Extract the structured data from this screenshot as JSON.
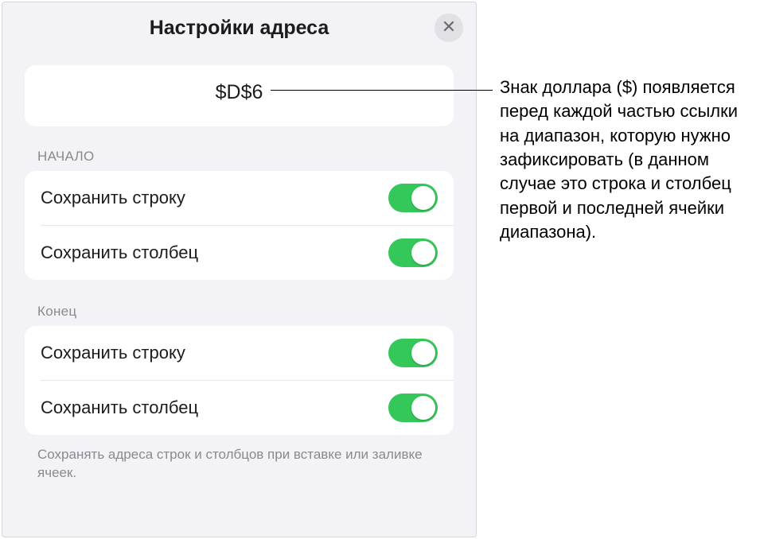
{
  "panel": {
    "title": "Настройки адреса",
    "formula": "$D$6"
  },
  "sections": {
    "start": {
      "label": "НАЧАЛО",
      "rows": [
        {
          "label": "Сохранить строку",
          "on": true
        },
        {
          "label": "Сохранить столбец",
          "on": true
        }
      ]
    },
    "end": {
      "label": "Конец",
      "rows": [
        {
          "label": "Сохранить строку",
          "on": true
        },
        {
          "label": "Сохранить столбец",
          "on": true
        }
      ]
    }
  },
  "footer": "Сохранять адреса строк и столбцов при вставке или заливке ячеек.",
  "callout": "Знак доллара ($) появляется перед каждой частью ссылки на диапазон, которую нужно зафиксировать (в данном случае это строка и столбец первой и последней ячейки диапазона)."
}
